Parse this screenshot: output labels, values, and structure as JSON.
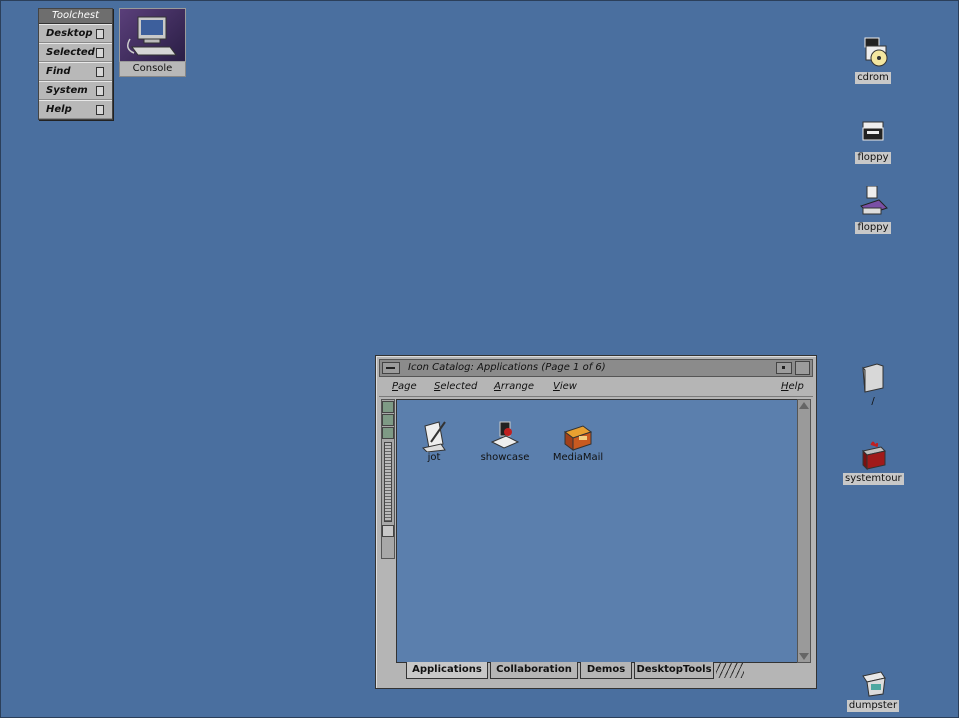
{
  "toolchest": {
    "title": "Toolchest",
    "items": [
      {
        "label": "Desktop"
      },
      {
        "label": "Selected"
      },
      {
        "label": "Find"
      },
      {
        "label": "System"
      },
      {
        "label": "Help"
      }
    ]
  },
  "console": {
    "label": "Console"
  },
  "desktop_icons": {
    "cdrom": "cdrom",
    "floppy1": "floppy",
    "floppy2": "floppy",
    "root": "/",
    "systemtour": "systemtour",
    "dumpster": "dumpster"
  },
  "window": {
    "title": "Icon Catalog: Applications (Page 1 of 6)",
    "menu": {
      "page": "Page",
      "selected": "Selected",
      "arrange": "Arrange",
      "view": "View",
      "help": "Help"
    },
    "icons": [
      {
        "label": "jot"
      },
      {
        "label": "showcase"
      },
      {
        "label": "MediaMail"
      }
    ],
    "tabs": [
      {
        "label": "Applications"
      },
      {
        "label": "Collaboration"
      },
      {
        "label": "Demos"
      },
      {
        "label": "DesktopTools"
      }
    ]
  },
  "colors": {
    "desktop": "#4a6f9f",
    "catalog_bg": "#5b7fad",
    "chrome": "#b5b5b5"
  }
}
